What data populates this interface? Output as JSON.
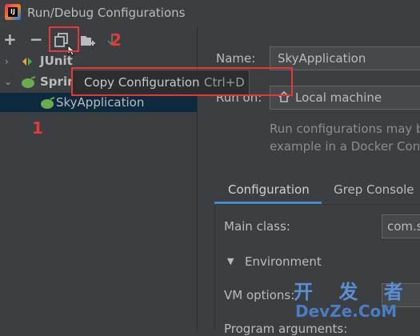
{
  "window": {
    "title": "Run/Debug Configurations"
  },
  "toolbar": {
    "add_icon": "plus-icon",
    "remove_icon": "minus-icon",
    "copy_icon": "copy-icon",
    "folder_icon": "folder-add-icon",
    "sort_icon": "sort-icon"
  },
  "tree": {
    "items": [
      {
        "label": "JUnit"
      },
      {
        "label": "Spring"
      },
      {
        "label": "SkyApplication"
      }
    ]
  },
  "tooltip": {
    "label": "Copy Configuration",
    "shortcut": "Ctrl+D"
  },
  "annotations": {
    "one": "1",
    "two": "2"
  },
  "form": {
    "name_label": "Name:",
    "name_value": "SkyApplication",
    "run_on_label": "Run on:",
    "run_on_value": "Local machine",
    "hint_line1": "Run configurations may be",
    "hint_line2": "example in a Docker Conta"
  },
  "tabs": [
    {
      "label": "Configuration"
    },
    {
      "label": "Grep Console"
    }
  ],
  "config": {
    "main_class_label": "Main class:",
    "main_class_value": "com.s",
    "environment_label": "Environment",
    "vm_options_label": "VM options:",
    "program_args_label": "Program arguments:"
  },
  "watermark": {
    "cn": "开 发 者",
    "en": "DevZe.CoM"
  },
  "colors": {
    "accent": "#4a88c7",
    "highlight": "#e53935",
    "selection": "#0d293e"
  }
}
